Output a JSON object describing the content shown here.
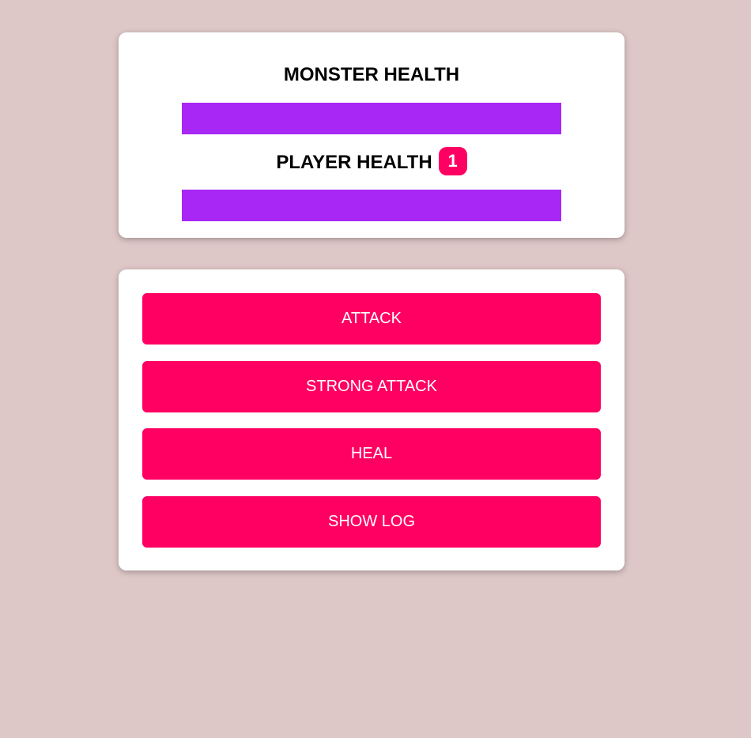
{
  "colors": {
    "background": "#dec7c7",
    "health_fill": "#a827f5",
    "accent": "#ff0062"
  },
  "health": {
    "monster_title": "MONSTER HEALTH",
    "monster_level": 1.0,
    "player_title": "PLAYER HEALTH",
    "player_badge": "1",
    "player_level": 1.0
  },
  "controls": {
    "attack_label": "ATTACK",
    "strong_attack_label": "STRONG ATTACK",
    "heal_label": "HEAL",
    "show_log_label": "SHOW LOG"
  }
}
